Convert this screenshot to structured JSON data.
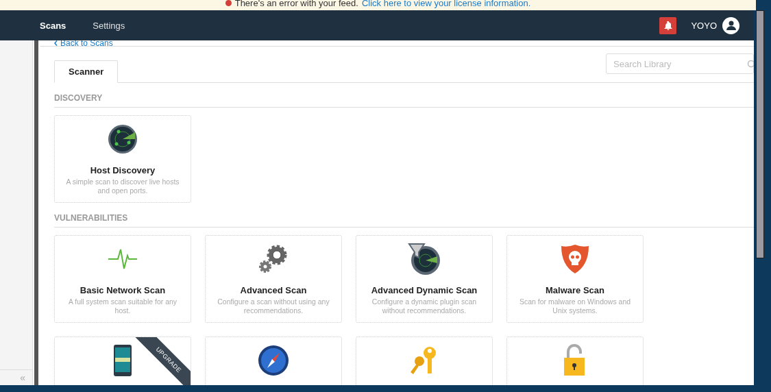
{
  "banner": {
    "message": "There's an error with your feed.",
    "link": "Click here to view your license information."
  },
  "nav": {
    "items": [
      {
        "label": "Scans",
        "selected": true
      },
      {
        "label": "Settings",
        "selected": false
      }
    ],
    "user": "YOYO"
  },
  "back_link": "Back to Scans",
  "tabs": [
    {
      "label": "Scanner",
      "selected": true
    }
  ],
  "search": {
    "placeholder": "Search Library"
  },
  "sidebar": {
    "collapse": "«"
  },
  "sections": [
    {
      "title": "DISCOVERY",
      "cards": [
        {
          "kind": "radar",
          "title": "Host Discovery",
          "description": "A simple scan to discover live hosts and open ports."
        }
      ]
    },
    {
      "title": "VULNERABILITIES",
      "cards": [
        {
          "kind": "pulse",
          "title": "Basic Network Scan",
          "description": "A full system scan suitable for any host."
        },
        {
          "kind": "gears",
          "title": "Advanced Scan",
          "description": "Configure a scan without using any recommendations."
        },
        {
          "kind": "dynamic",
          "title": "Advanced Dynamic Scan",
          "description": "Configure a dynamic plugin scan without recommendations."
        },
        {
          "kind": "malware",
          "title": "Malware Scan",
          "description": "Scan for malware on Windows and Unix systems."
        },
        {
          "kind": "mobile",
          "ribbon": "UPGRADE"
        },
        {
          "kind": "compass"
        },
        {
          "kind": "keys"
        },
        {
          "kind": "lock"
        }
      ]
    }
  ]
}
